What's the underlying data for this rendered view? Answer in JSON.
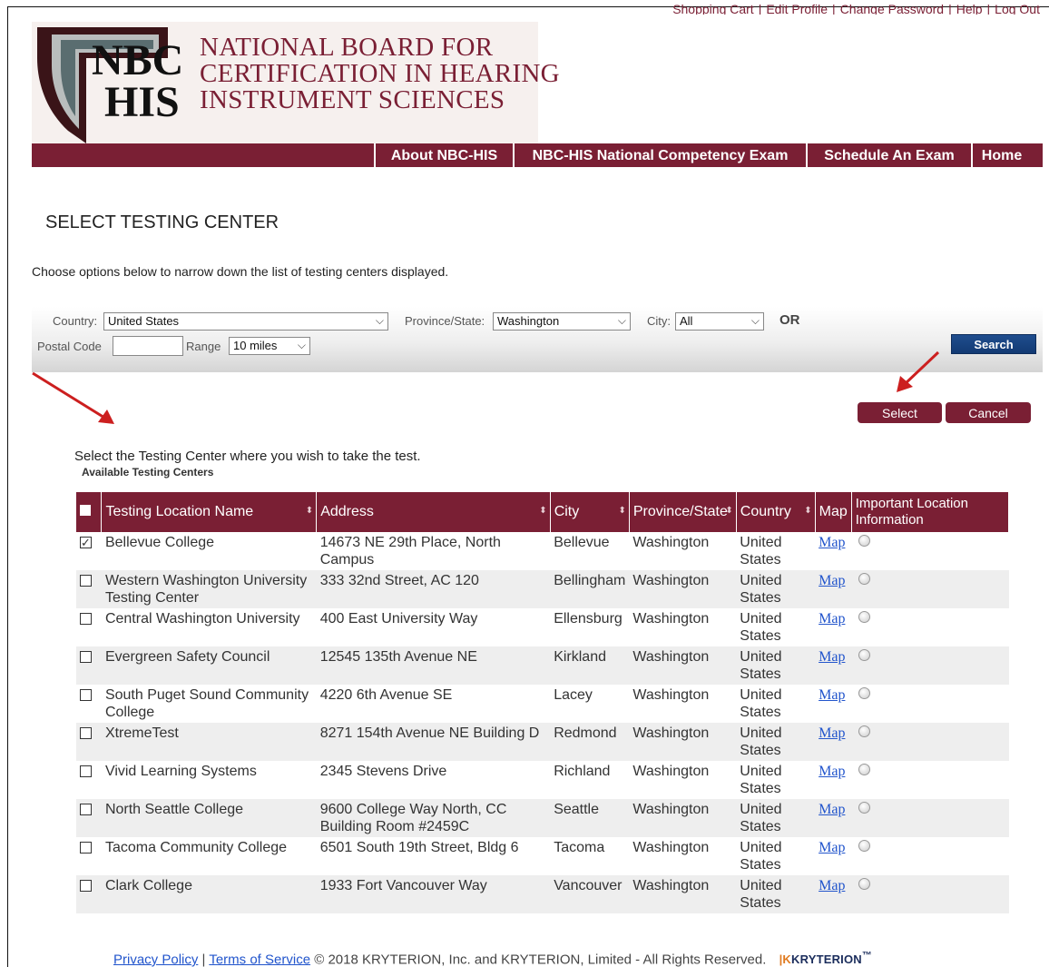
{
  "top_links": [
    "Shopping Cart",
    "Edit Profile",
    "Change Password",
    "Help",
    "Log Out"
  ],
  "logo": {
    "abbrev_line1": "NBC",
    "abbrev_line2": "HIS",
    "name_line1": "NATIONAL BOARD FOR",
    "name_line2": "CERTIFICATION IN HEARING",
    "name_line3": "INSTRUMENT SCIENCES"
  },
  "nav": {
    "about": "About NBC-HIS",
    "exam": "NBC-HIS National Competency Exam",
    "schedule": "Schedule An Exam",
    "home": "Home"
  },
  "page_title": "SELECT TESTING CENTER",
  "intro": "Choose options below to narrow down the list of testing centers displayed.",
  "filters": {
    "country_label": "Country:",
    "country_value": "United States",
    "state_label": "Province/State:",
    "state_value": "Washington",
    "city_label": "City:",
    "city_value": "All",
    "or_label": "OR",
    "postal_label": "Postal Code",
    "postal_value": "",
    "range_label": "Range",
    "range_value": "10 miles",
    "search_button": "Search"
  },
  "actions": {
    "select_button": "Select",
    "cancel_button": "Cancel"
  },
  "select_intro": "Select the Testing Center where you wish to take the test.",
  "available_label": "Available Testing Centers",
  "table": {
    "headers": {
      "name": "Testing Location Name",
      "address": "Address",
      "city": "City",
      "state": "Province/State",
      "country": "Country",
      "map": "Map",
      "info": "Important Location Information"
    },
    "map_link": "Map",
    "rows": [
      {
        "checked": true,
        "name": "Bellevue College",
        "address": "14673 NE 29th Place, North Campus",
        "city": "Bellevue",
        "state": "Washington",
        "country": "United States"
      },
      {
        "checked": false,
        "name": "Western Washington University Testing Center",
        "address": "333 32nd Street, AC 120",
        "city": "Bellingham",
        "state": "Washington",
        "country": "United States"
      },
      {
        "checked": false,
        "name": "Central Washington University",
        "address": "400 East University Way",
        "city": "Ellensburg",
        "state": "Washington",
        "country": "United States"
      },
      {
        "checked": false,
        "name": "Evergreen Safety Council",
        "address": "12545 135th Avenue NE",
        "city": "Kirkland",
        "state": "Washington",
        "country": "United States"
      },
      {
        "checked": false,
        "name": "South Puget Sound Community College",
        "address": "4220 6th Avenue SE",
        "city": "Lacey",
        "state": "Washington",
        "country": "United States"
      },
      {
        "checked": false,
        "name": "XtremeTest",
        "address": "8271 154th Avenue NE Building D",
        "city": "Redmond",
        "state": "Washington",
        "country": "United States"
      },
      {
        "checked": false,
        "name": "Vivid Learning Systems",
        "address": "2345 Stevens Drive",
        "city": "Richland",
        "state": "Washington",
        "country": "United States"
      },
      {
        "checked": false,
        "name": "North Seattle College",
        "address": "9600 College Way North, CC Building Room #2459C",
        "city": "Seattle",
        "state": "Washington",
        "country": "United States"
      },
      {
        "checked": false,
        "name": "Tacoma Community College",
        "address": "6501 South 19th Street, Bldg 6",
        "city": "Tacoma",
        "state": "Washington",
        "country": "United States"
      },
      {
        "checked": false,
        "name": "Clark College",
        "address": "1933 Fort Vancouver Way",
        "city": "Vancouver",
        "state": "Washington",
        "country": "United States"
      }
    ]
  },
  "footer": {
    "privacy": "Privacy Policy",
    "terms": "Terms of Service",
    "copyright": "© 2018  KRYTERION, Inc. and KRYTERION, Limited - All Rights Reserved.",
    "logo_text": "KRYTERION",
    "logo_mark": "™"
  },
  "colors": {
    "brand": "#7a1f34",
    "search_button": "#1f4d8e",
    "annotation_arrow": "#cc1f1f"
  },
  "icons": [
    "shield-logo-icon",
    "sort-icon",
    "info-icon",
    "chevron-down-icon",
    "arrow-annotation-icon"
  ]
}
